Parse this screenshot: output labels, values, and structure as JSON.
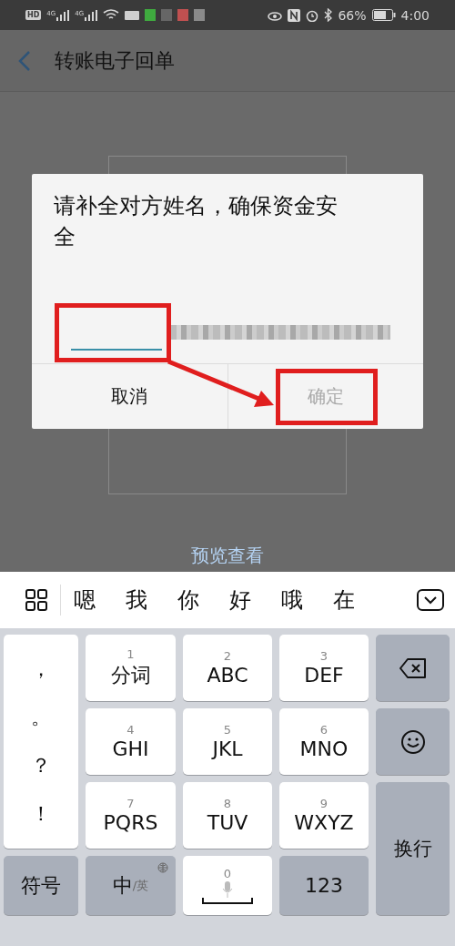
{
  "status_bar": {
    "hd": "HD",
    "networks": [
      "4G",
      "4G"
    ],
    "battery": "66%",
    "time": "4:00"
  },
  "app_bar": {
    "title": "转账电子回单"
  },
  "page": {
    "preview_link": "预览查看"
  },
  "dialog": {
    "title": "请补全对方姓名，确保资金安全",
    "buttons": [
      {
        "label": "取消",
        "disabled": false
      },
      {
        "label": "确定",
        "disabled": true
      }
    ]
  },
  "keyboard": {
    "candidates": [
      "嗯",
      "我",
      "你",
      "好",
      "哦",
      "在"
    ],
    "punctuation": [
      "，",
      "。",
      "？",
      "！"
    ],
    "keys": [
      {
        "number": "1",
        "label": "分词"
      },
      {
        "number": "2",
        "label": "ABC"
      },
      {
        "number": "3",
        "label": "DEF"
      },
      {
        "number": "4",
        "label": "GHI"
      },
      {
        "number": "5",
        "label": "JKL"
      },
      {
        "number": "6",
        "label": "MNO"
      },
      {
        "number": "7",
        "label": "PQRS"
      },
      {
        "number": "8",
        "label": "TUV"
      },
      {
        "number": "9",
        "label": "WXYZ"
      }
    ],
    "enter": "换行",
    "symbols": "符号",
    "language": {
      "main": "中",
      "alt": "/英"
    },
    "space_number": "0",
    "numbers": "123"
  }
}
